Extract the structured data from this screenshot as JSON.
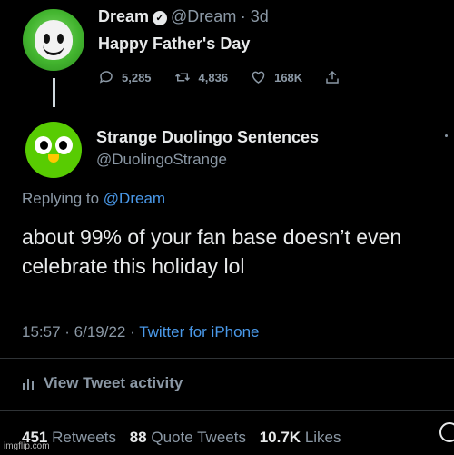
{
  "parent_tweet": {
    "name": "Dream",
    "handle": "@Dream",
    "time": "· 3d",
    "text": "Happy Father's Day",
    "replies": "5,285",
    "retweets": "4,836",
    "likes": "168K"
  },
  "reply_tweet": {
    "name": "Strange Duolingo Sentences",
    "handle": "@DuolingoStrange",
    "replying_prefix": "Replying to",
    "replying_to": "@Dream",
    "text": "about 99% of your fan base doesn’t even celebrate this holiday lol",
    "time": "15:57",
    "date": "· 6/19/22 ·",
    "source": "Twitter for iPhone",
    "activity_label": "View Tweet activity",
    "retweets_count": "451",
    "retweets_label": "Retweets",
    "quote_count": "88",
    "quote_label": "Quote Tweets",
    "likes_count": "10.7K",
    "likes_label": "Likes"
  },
  "watermark": "imgflip.com",
  "colors": {
    "background": "#000000",
    "link": "#4a99e9",
    "secondary_text": "#8b98a5",
    "duolingo_green": "#58cc02"
  }
}
